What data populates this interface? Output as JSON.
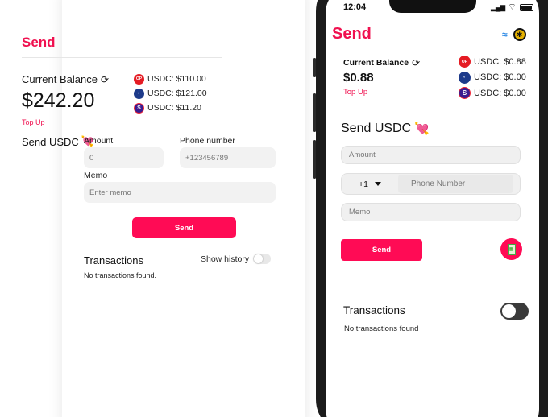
{
  "web": {
    "title": "Send",
    "balance": {
      "label": "Current Balance",
      "value": "$242.20",
      "top_up": "Top Up",
      "tokens": [
        {
          "icon": "red-circle-icon",
          "text": "USDC: $110.00"
        },
        {
          "icon": "blue-swirl-icon",
          "text": "USDC: $121.00"
        },
        {
          "icon": "purple-s-icon",
          "text": "USDC: $11.20"
        }
      ]
    },
    "send_heading": "Send USDC",
    "amount_label": "Amount",
    "amount_value": "0",
    "phone_label": "Phone number",
    "phone_placeholder": "+123456789",
    "memo_label": "Memo",
    "memo_placeholder": "Enter memo",
    "send_button": "Send",
    "transactions_title": "Transactions",
    "show_history_label": "Show history",
    "show_history_on": false,
    "no_transactions": "No transactions found."
  },
  "mobile": {
    "status": {
      "time": "12:04"
    },
    "title": "Send",
    "balance": {
      "label": "Current Balance",
      "value": "$0.88",
      "top_up": "Top Up",
      "tokens": [
        {
          "icon": "red-circle-icon",
          "text": "USDC: $0.88"
        },
        {
          "icon": "blue-swirl-icon",
          "text": "USDC: $0.00"
        },
        {
          "icon": "purple-s-icon",
          "text": "USDC: $0.00"
        }
      ]
    },
    "send_heading": "Send USDC",
    "amount_placeholder": "Amount",
    "country_code": "+1",
    "phone_placeholder": "Phone Number",
    "memo_placeholder": "Memo",
    "send_button": "Send",
    "transactions_title": "Transactions",
    "toggle_on": true,
    "no_transactions": "No transactions found"
  },
  "colors": {
    "accent": "#ff0b55",
    "title": "#f0104f"
  }
}
